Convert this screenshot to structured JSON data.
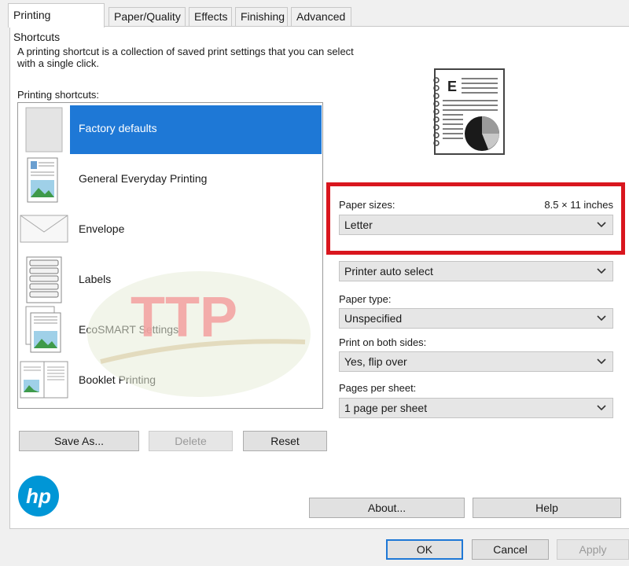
{
  "tabs": [
    "Printing Shortcuts",
    "Paper/Quality",
    "Effects",
    "Finishing",
    "Advanced"
  ],
  "description": "A printing shortcut is a collection of saved print settings that you can select with a single click.",
  "shortcuts_label": "Printing shortcuts:",
  "shortcuts": [
    {
      "label": "Factory defaults",
      "icon": "blank-page-icon",
      "selected": true
    },
    {
      "label": "General Everyday Printing",
      "icon": "document-image-icon"
    },
    {
      "label": "Envelope",
      "icon": "envelope-icon"
    },
    {
      "label": "Labels",
      "icon": "labels-sheet-icon"
    },
    {
      "label": "EcoSMART Settings",
      "icon": "eco-document-icon"
    },
    {
      "label": "Booklet Printing",
      "icon": "booklet-icon"
    }
  ],
  "buttons": {
    "save_as": "Save As...",
    "delete": "Delete",
    "reset": "Reset",
    "about": "About...",
    "help": "Help"
  },
  "paper_sizes": {
    "label": "Paper sizes:",
    "size_text": "8.5 × 11 inches",
    "value": "Letter"
  },
  "paper_source": {
    "value": "Printer auto select"
  },
  "paper_type": {
    "label": "Paper type:",
    "value": "Unspecified"
  },
  "both_sides": {
    "label": "Print on both sides:",
    "value": "Yes, flip over"
  },
  "pages_per_sheet": {
    "label": "Pages per sheet:",
    "value": "1 page per sheet"
  },
  "footer": {
    "ok": "OK",
    "cancel": "Cancel",
    "apply": "Apply"
  },
  "logo_text": "hp",
  "watermark_text": "TTP",
  "colors": {
    "accent": "#1e78d6",
    "highlight_box": "#d9161e",
    "hp_blue": "#0096d6",
    "watermark": "#f4a0a0"
  }
}
